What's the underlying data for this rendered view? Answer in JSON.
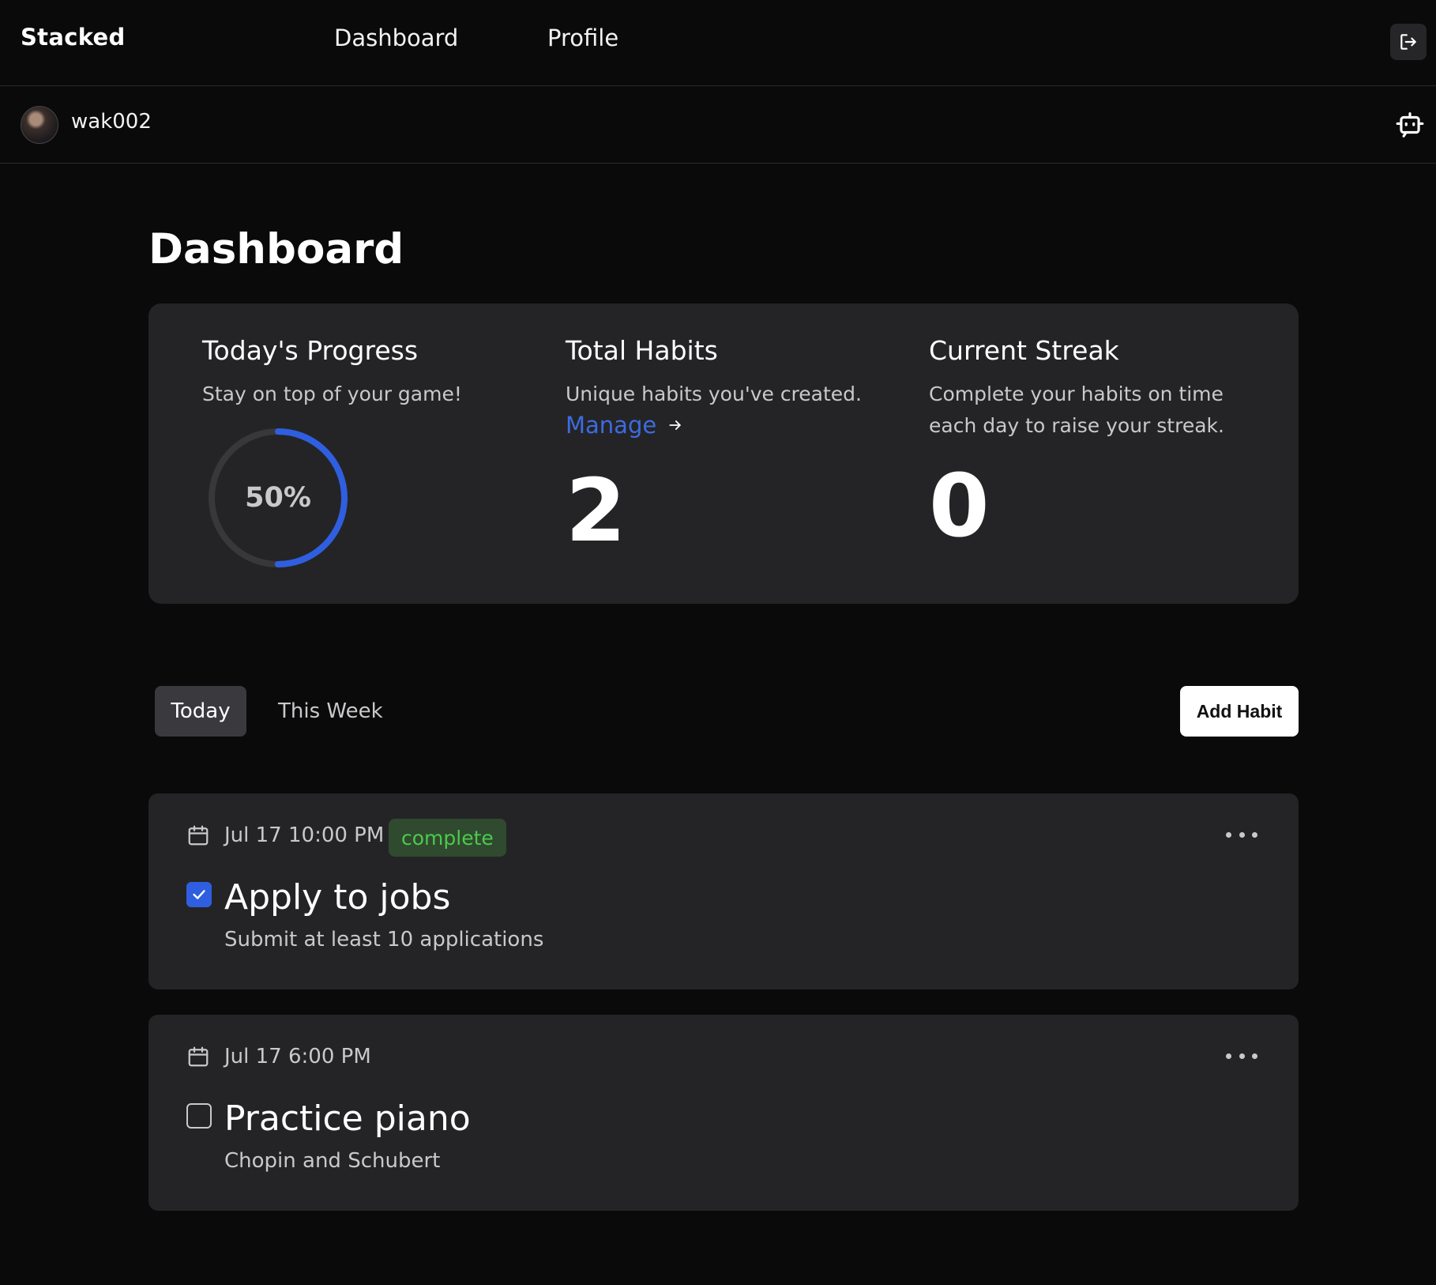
{
  "nav": {
    "brand": "Stacked",
    "links": [
      "Dashboard",
      "Profile"
    ],
    "logout_icon": "logout-icon"
  },
  "user": {
    "username": "wak002",
    "bot_icon": "bot-icon"
  },
  "page": {
    "title": "Dashboard"
  },
  "stats": {
    "progress": {
      "title": "Today's Progress",
      "description": "Stay on top of your game!",
      "value_label": "50%",
      "fraction": 0.5
    },
    "total_habits": {
      "title": "Total Habits",
      "description": "Unique habits you've created.",
      "manage_label": "Manage",
      "value": "2"
    },
    "streak": {
      "title": "Current Streak",
      "description": "Complete your habits on time each day to raise your streak.",
      "value": "0"
    }
  },
  "tabs": [
    "Today",
    "This Week"
  ],
  "add_habit_label": "Add Habit",
  "habits": [
    {
      "date": "Jul 17 10:00 PM",
      "status": "complete",
      "title": "Apply to jobs",
      "description": "Submit at least 10 applications",
      "checked": true
    },
    {
      "date": "Jul 17 6:00 PM",
      "status": "",
      "title": "Practice piano",
      "description": "Chopin and Schubert",
      "checked": false
    }
  ],
  "colors": {
    "background": "#0a0a0b",
    "card": "#242426",
    "accent": "#2f5fe0",
    "link": "#3d6be0",
    "badge_text": "#4cc94c",
    "badge_bg": "#2f4a2f",
    "ring_track": "#38383b"
  }
}
